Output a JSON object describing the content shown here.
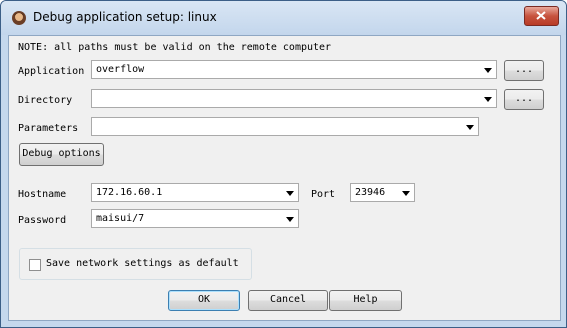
{
  "window": {
    "title": "Debug application setup: linux"
  },
  "note": "NOTE: all paths must be valid on the remote computer",
  "application": {
    "label": "Application",
    "value": "overflow",
    "browse": "..."
  },
  "directory": {
    "label": "Directory",
    "value": "",
    "browse": "..."
  },
  "parameters": {
    "label": "Parameters",
    "value": ""
  },
  "debug_options": {
    "label": "Debug options"
  },
  "hostname": {
    "label": "Hostname",
    "value": "172.16.60.1"
  },
  "port": {
    "label": "Port",
    "value": "23946"
  },
  "password": {
    "label": "Password",
    "value": "maisui/7"
  },
  "save_default": {
    "label": "Save network settings as default",
    "checked": false
  },
  "buttons": {
    "ok": "OK",
    "cancel": "Cancel",
    "help": "Help"
  }
}
